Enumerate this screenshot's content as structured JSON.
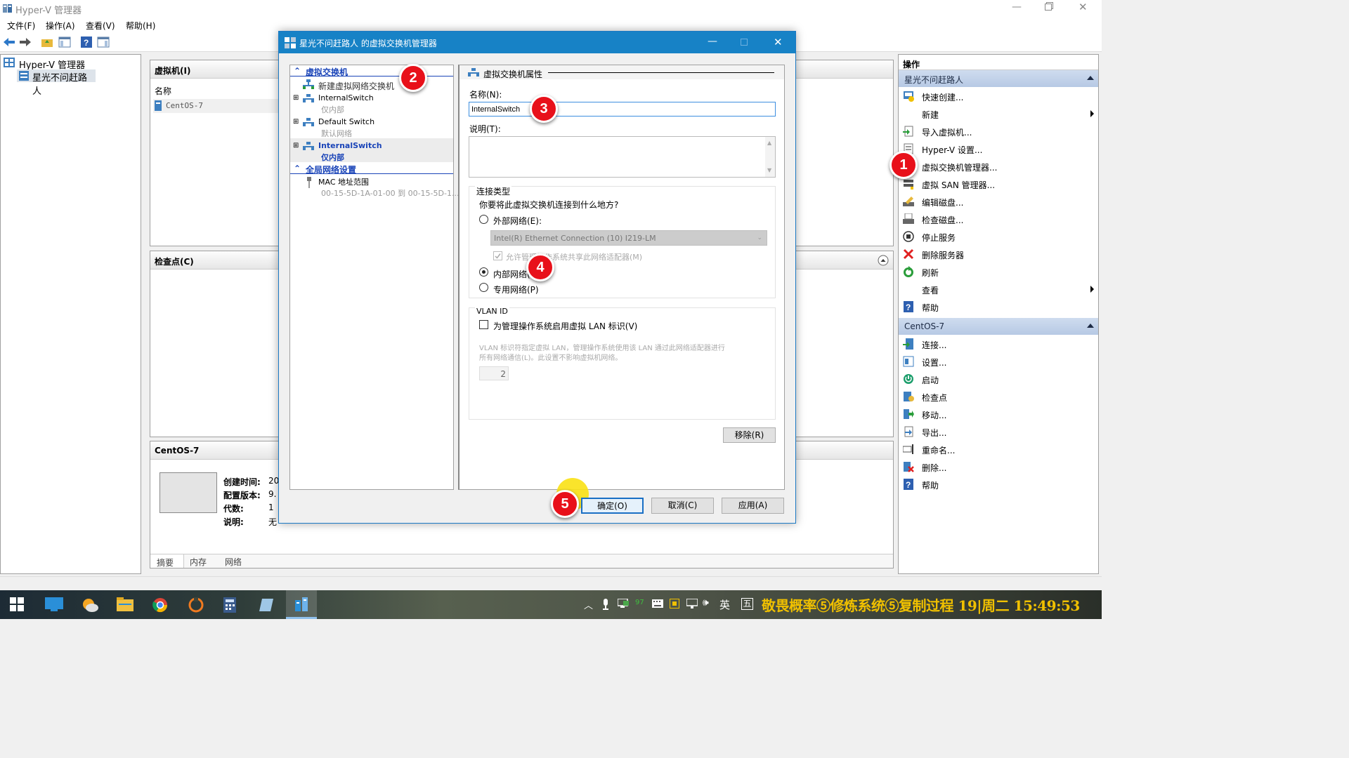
{
  "app": {
    "title": "Hyper-V 管理器"
  },
  "menu": [
    "文件(F)",
    "操作(A)",
    "查看(V)",
    "帮助(H)"
  ],
  "tree": {
    "root": "Hyper-V 管理器",
    "server": "星光不问赶路人"
  },
  "vm_panel": {
    "title": "虚拟机(I)",
    "col_name": "名称",
    "rows": [
      "CentOS-7"
    ]
  },
  "checkpoints": {
    "title": "检查点(C)"
  },
  "details": {
    "title": "CentOS-7",
    "fields": [
      {
        "label": "创建时间:",
        "value": "20"
      },
      {
        "label": "配置版本:",
        "value": "9."
      },
      {
        "label": "代数:",
        "value": "1"
      },
      {
        "label": "说明:",
        "value": "无"
      }
    ],
    "tabs": [
      "摘要",
      "内存",
      "网络"
    ]
  },
  "actions": {
    "header": "操作",
    "sections": [
      {
        "title": "星光不问赶路人",
        "items": [
          {
            "label": "快速创建...",
            "icon": "quick-create-icon"
          },
          {
            "label": "新建",
            "icon": "blank",
            "submenu": true
          },
          {
            "label": "导入虚拟机...",
            "icon": "import-icon"
          },
          {
            "label": "Hyper-V 设置...",
            "icon": "settings-icon"
          },
          {
            "label": "虚拟交换机管理器...",
            "icon": "switch-icon"
          },
          {
            "label": "虚拟 SAN 管理器...",
            "icon": "san-icon"
          },
          {
            "label": "编辑磁盘...",
            "icon": "edit-disk-icon"
          },
          {
            "label": "检查磁盘...",
            "icon": "inspect-disk-icon"
          },
          {
            "label": "停止服务",
            "icon": "stop-icon"
          },
          {
            "label": "删除服务器",
            "icon": "delete-x-icon"
          },
          {
            "label": "刷新",
            "icon": "refresh-icon"
          },
          {
            "label": "查看",
            "icon": "blank",
            "submenu": true
          },
          {
            "label": "帮助",
            "icon": "help-icon"
          }
        ]
      },
      {
        "title": "CentOS-7",
        "items": [
          {
            "label": "连接...",
            "icon": "connect-icon"
          },
          {
            "label": "设置...",
            "icon": "vm-settings-icon"
          },
          {
            "label": "启动",
            "icon": "power-icon"
          },
          {
            "label": "检查点",
            "icon": "checkpoint-icon"
          },
          {
            "label": "移动...",
            "icon": "move-icon"
          },
          {
            "label": "导出...",
            "icon": "export-icon"
          },
          {
            "label": "重命名...",
            "icon": "rename-icon"
          },
          {
            "label": "删除...",
            "icon": "delete-vm-icon"
          },
          {
            "label": "帮助",
            "icon": "help-icon"
          }
        ]
      }
    ]
  },
  "dialog": {
    "title": "星光不问赶路人 的虚拟交换机管理器",
    "tree": {
      "section1": "虚拟交换机",
      "new_switch": "新建虚拟网络交换机",
      "switches": [
        {
          "name": "InternalSwitch",
          "type": "仅内部"
        },
        {
          "name": "Default Switch",
          "type": "默认网络"
        },
        {
          "name": "InternalSwitch",
          "type": "仅内部",
          "selected": true
        }
      ],
      "section2": "全局网络设置",
      "mac": {
        "name": "MAC 地址范围",
        "value": "00-15-5D-1A-01-00 到 00-15-5D-1..."
      }
    },
    "props": {
      "header": "虚拟交换机属性",
      "name_label": "名称(N):",
      "name_value": "InternalSwitch",
      "desc_label": "说明(T):",
      "conn_group": "连接类型",
      "conn_question": "你要将此虚拟交换机连接到什么地方?",
      "external": "外部网络(E):",
      "adapter": "Intel(R) Ethernet Connection (10) I219-LM",
      "allow_share": "允许管理操作系统共享此网络适配器(M)",
      "internal": "内部网络(I)",
      "private": "专用网络(P)",
      "selected_connection": "internal",
      "vlan_group": "VLAN ID",
      "vlan_check": "为管理操作系统启用虚拟 LAN 标识(V)",
      "vlan_help1": "VLAN 标识符指定虚拟 LAN，管理操作系统使用该 LAN 通过此网络适配器进行",
      "vlan_help2": "所有网络通信(L)。此设置不影响虚拟机网络。",
      "vlan_value": "2",
      "remove_button": "移除(R)"
    },
    "buttons": {
      "ok": "确定(O)",
      "cancel": "取消(C)",
      "apply": "应用(A)"
    }
  },
  "callouts": [
    "1",
    "2",
    "3",
    "4",
    "5"
  ],
  "taskbar": {
    "tray_badge": "97",
    "ime_lang": "英",
    "ime_mode": "五",
    "clock_text": "敬畏概率⑤修炼系统⑤复制过程 19|周二 15:49:53"
  },
  "colors": {
    "accent": "#1782c6",
    "callout": "#e8101a",
    "clock": "#f0c000",
    "link": "#1a44b8"
  }
}
